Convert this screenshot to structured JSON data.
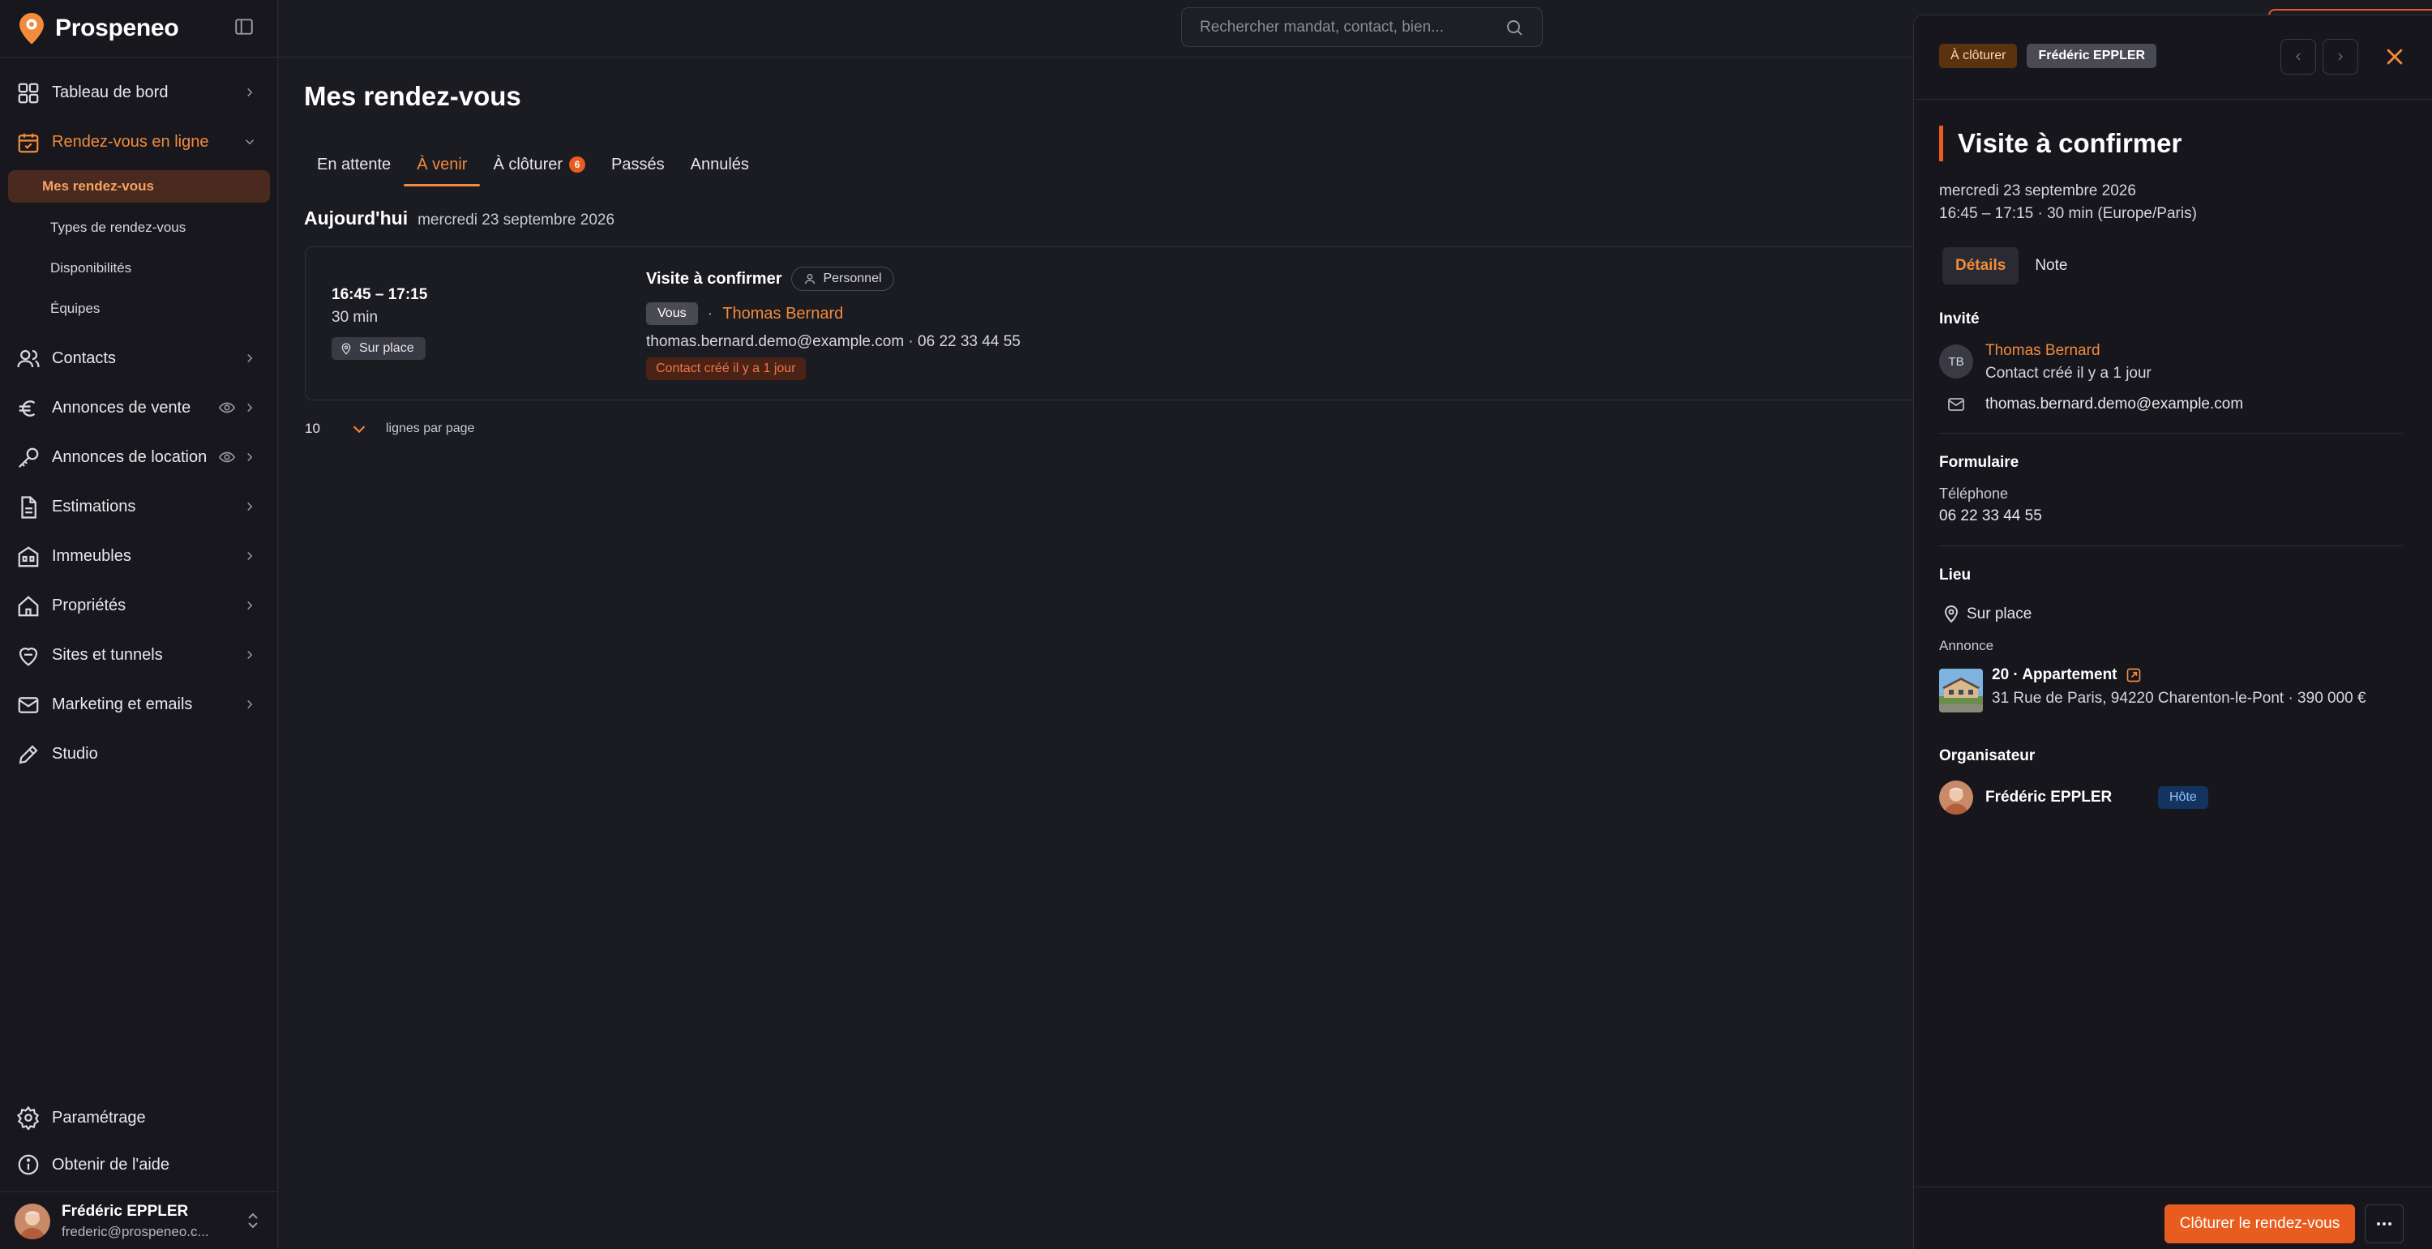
{
  "app": {
    "name": "Prospeneo"
  },
  "colors": {
    "accent": "#f28b3c",
    "primary_button": "#e85d1f",
    "background": "#1b1b22",
    "sidebar": "#17171d"
  },
  "search": {
    "placeholder": "Rechercher mandat, contact, bien..."
  },
  "sidebar": {
    "items": [
      {
        "label": "Tableau de bord",
        "icon": "dashboard-icon"
      },
      {
        "label": "Rendez-vous en ligne",
        "icon": "calendar-icon",
        "active": true,
        "children": [
          {
            "label": "Mes rendez-vous",
            "active": true
          },
          {
            "label": "Types de rendez-vous"
          },
          {
            "label": "Disponibilités"
          },
          {
            "label": "Équipes"
          }
        ]
      },
      {
        "label": "Contacts",
        "icon": "contacts-icon"
      },
      {
        "label": "Annonces de vente",
        "icon": "euro-icon"
      },
      {
        "label": "Annonces de location",
        "icon": "key-icon"
      },
      {
        "label": "Estimations",
        "icon": "document-icon"
      },
      {
        "label": "Immeubles",
        "icon": "building-icon"
      },
      {
        "label": "Propriétés",
        "icon": "house-icon"
      },
      {
        "label": "Sites et tunnels",
        "icon": "sites-icon"
      },
      {
        "label": "Marketing et emails",
        "icon": "mail-icon"
      },
      {
        "label": "Studio",
        "icon": "pencil-icon"
      }
    ],
    "bottom": [
      {
        "label": "Paramétrage",
        "icon": "gear-icon"
      },
      {
        "label": "Obtenir de l'aide",
        "icon": "info-icon"
      }
    ],
    "user": {
      "name": "Frédéric EPPLER",
      "email": "frederic@prospeneo.c..."
    }
  },
  "main": {
    "title": "Mes rendez-vous",
    "tabs": [
      {
        "label": "En attente"
      },
      {
        "label": "À venir",
        "active": true
      },
      {
        "label": "À clôturer",
        "count": "6"
      },
      {
        "label": "Passés"
      },
      {
        "label": "Annulés"
      }
    ],
    "day": {
      "title": "Aujourd'hui",
      "date": "mercredi 23 septembre 2026"
    },
    "appointment": {
      "time": "16:45 – 17:15",
      "duration": "30 min",
      "place": "Sur place",
      "title": "Visite à confirmer",
      "type": "Personnel",
      "you_label": "Vous",
      "separator": "·",
      "guest": "Thomas Bernard",
      "contact": "thomas.bernard.demo@example.com · 06 22 33 44 55",
      "new_contact": "Contact créé il y a 1 jour"
    },
    "pagination": {
      "page_size": "10",
      "label": "lignes par page"
    }
  },
  "panel": {
    "status_badge": "À clôturer",
    "owner_badge": "Frédéric EPPLER",
    "title": "Visite à confirmer",
    "date": "mercredi 23 septembre 2026",
    "time": "16:45 – 17:15 · 30 min (Europe/Paris)",
    "tabs": [
      {
        "label": "Détails",
        "active": true
      },
      {
        "label": "Note"
      }
    ],
    "invite": {
      "section": "Invité",
      "initials": "TB",
      "name": "Thomas Bernard",
      "meta": "Contact créé il y a 1 jour",
      "email": "thomas.bernard.demo@example.com"
    },
    "form": {
      "section": "Formulaire",
      "phone_label": "Téléphone",
      "phone": "06 22 33 44 55"
    },
    "location": {
      "section": "Lieu",
      "place": "Sur place",
      "listing_label": "Annonce",
      "listing_title": "20 · Appartement",
      "listing_address": "31 Rue de Paris, 94220 Charenton-le-Pont · 390 000 €"
    },
    "organizer": {
      "section": "Organisateur",
      "name": "Frédéric EPPLER",
      "role": "Hôte"
    },
    "primary_action": "Clôturer le rendez-vous"
  }
}
